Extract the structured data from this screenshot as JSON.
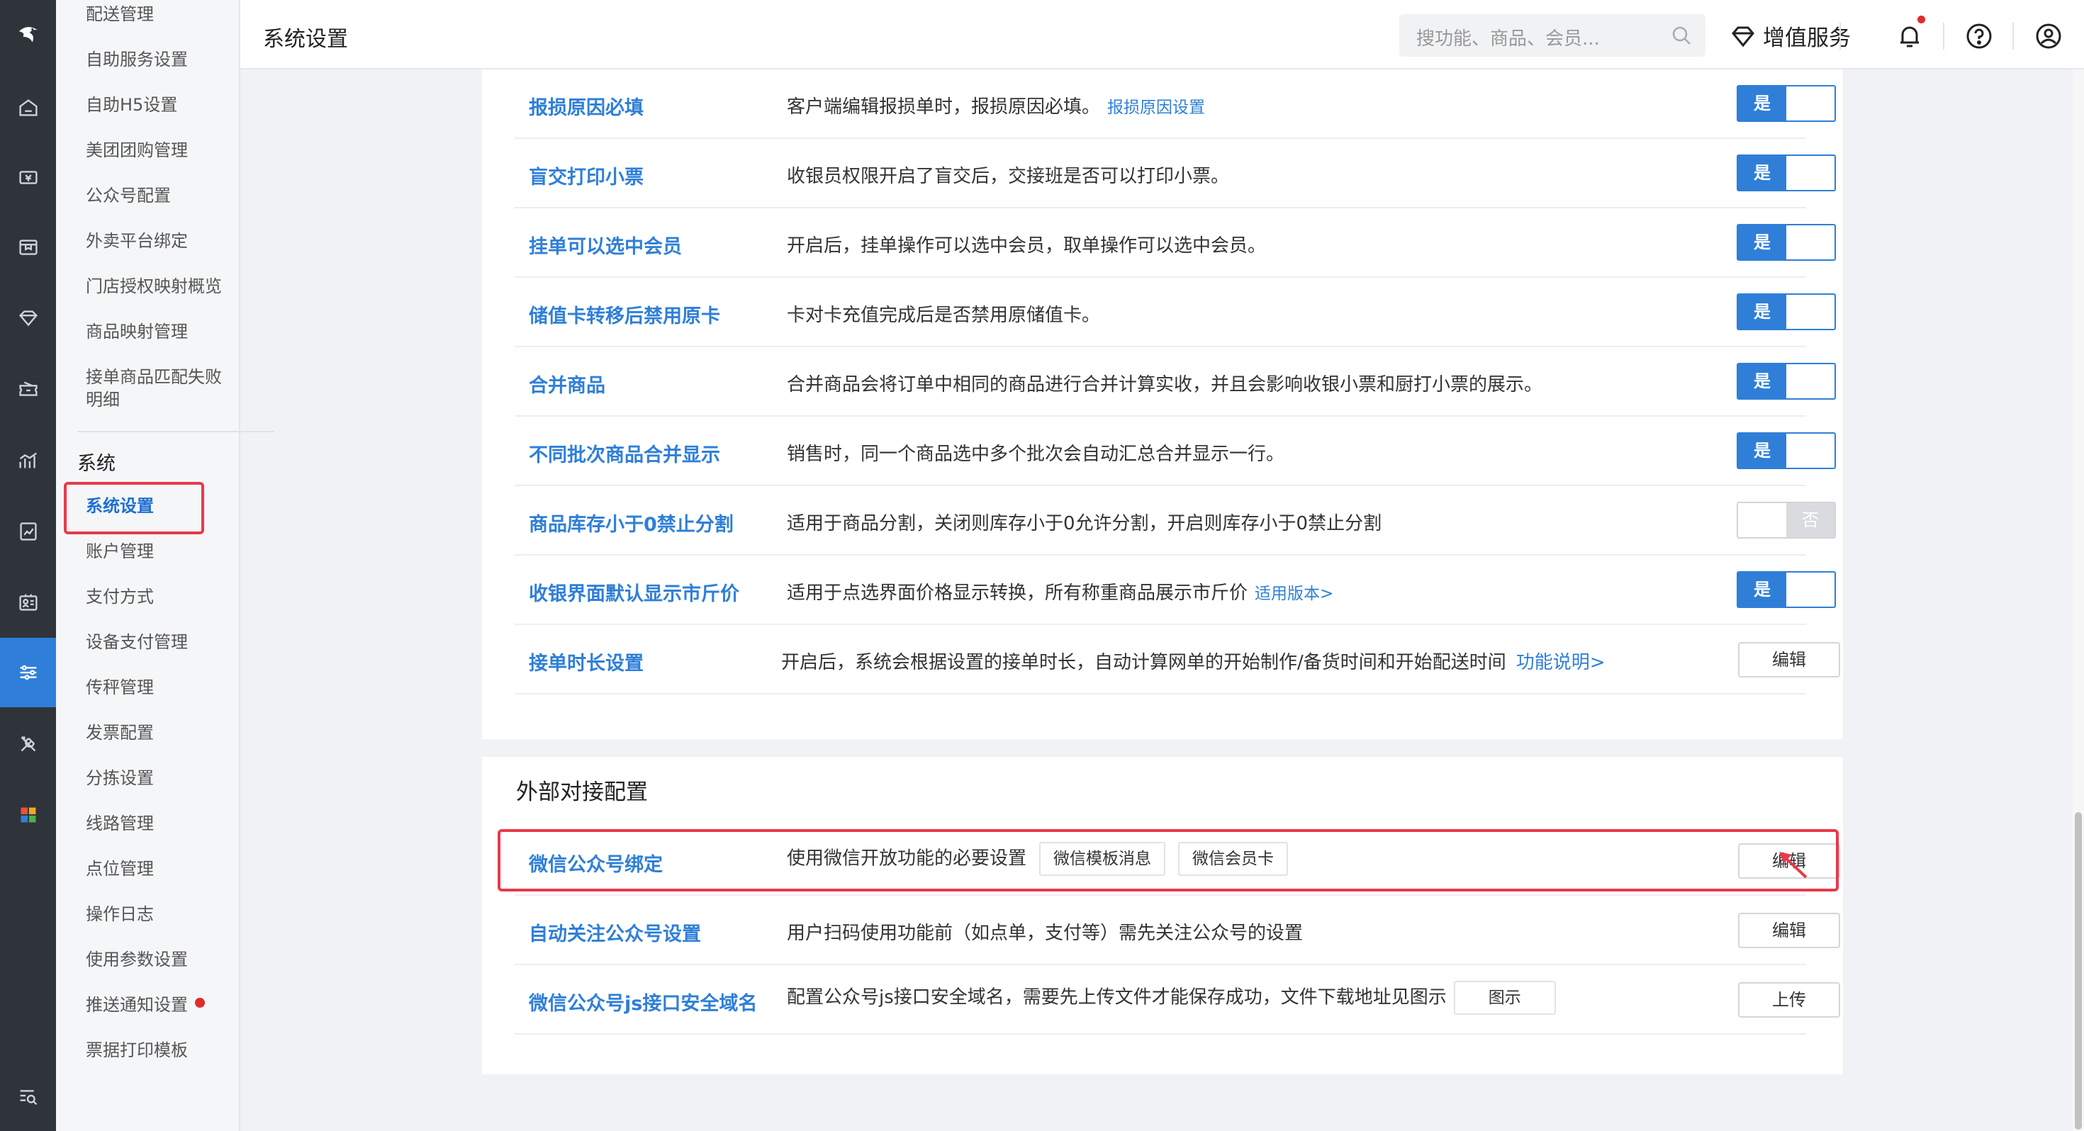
{
  "rail": {
    "logo_icon": "brand-logo-icon",
    "items": [
      "home-icon",
      "cashier-icon",
      "box-icon",
      "diamond-icon",
      "ticket-icon",
      "chart-icon",
      "report-icon",
      "idcard-icon",
      "settings-sliders-icon",
      "tools-icon",
      "apps-grid-icon",
      "search-list-icon"
    ]
  },
  "menu": {
    "items_top": [
      "配送管理",
      "自助服务设置",
      "自助H5设置",
      "美团团购管理",
      "公众号配置",
      "外卖平台绑定",
      "门店授权映射概览",
      "商品映射管理",
      "接单商品匹配失败明细"
    ],
    "section": "系统",
    "items_system": [
      "系统设置",
      "账户管理",
      "支付方式",
      "设备支付管理",
      "传秤管理",
      "发票配置",
      "分拣设置",
      "线路管理",
      "点位管理",
      "操作日志",
      "使用参数设置",
      "推送通知设置",
      "票据打印模板"
    ],
    "active": "系统设置"
  },
  "header": {
    "title": "系统设置",
    "search_placeholder": "搜功能、商品、会员...",
    "vas_label": "增值服务"
  },
  "settings": [
    {
      "title": "报损原因必填",
      "desc": "客户端编辑报损单时，报损原因必填。",
      "link": "报损原因设置",
      "control": "toggle",
      "state": "是"
    },
    {
      "title": "盲交打印小票",
      "desc": "收银员权限开启了盲交后，交接班是否可以打印小票。",
      "control": "toggle",
      "state": "是"
    },
    {
      "title": "挂单可以选中会员",
      "desc": "开启后，挂单操作可以选中会员，取单操作可以选中会员。",
      "control": "toggle",
      "state": "是"
    },
    {
      "title": "储值卡转移后禁用原卡",
      "desc": "卡对卡充值完成后是否禁用原储值卡。",
      "control": "toggle",
      "state": "是"
    },
    {
      "title": "合并商品",
      "desc": "合并商品会将订单中相同的商品进行合并计算实收，并且会影响收银小票和厨打小票的展示。",
      "control": "toggle",
      "state": "是"
    },
    {
      "title": "不同批次商品合并显示",
      "desc": "销售时，同一个商品选中多个批次会自动汇总合并显示一行。",
      "control": "toggle",
      "state": "是"
    },
    {
      "title": "商品库存小于0禁止分割",
      "desc": "适用于商品分割，关闭则库存小于0允许分割，开启则库存小于0禁止分割",
      "control": "toggle",
      "state": "否"
    },
    {
      "title": "收银界面默认显示市斤价",
      "desc": "适用于点选界面价格显示转换，所有称重商品展示市斤价",
      "link": "适用版本>",
      "control": "toggle",
      "state": "是"
    },
    {
      "title": "接单时长设置",
      "desc": "开启后，系统会根据设置的接单时长，自动计算网单的开始制作/备货时间和开始配送时间",
      "link": "功能说明>",
      "control": "button",
      "button": "编辑"
    }
  ],
  "external": {
    "section_title": "外部对接配置",
    "rows": [
      {
        "title": "微信公众号绑定",
        "desc": "使用微信开放功能的必要设置",
        "tags": [
          "微信模板消息",
          "微信会员卡"
        ],
        "button": "编辑"
      },
      {
        "title": "自动关注公众号设置",
        "desc": "用户扫码使用功能前（如点单，支付等）需先关注公众号的设置",
        "button": "编辑"
      },
      {
        "title": "微信公众号js接口安全域名",
        "desc": "配置公众号js接口安全域名，需要先上传文件才能保存成功，文件下载地址见图示",
        "tags": [
          "图示"
        ],
        "button": "上传"
      }
    ]
  },
  "colors": {
    "accent": "#2f7fd8",
    "highlight": "#e8394a",
    "rail_bg": "#2f343b"
  }
}
